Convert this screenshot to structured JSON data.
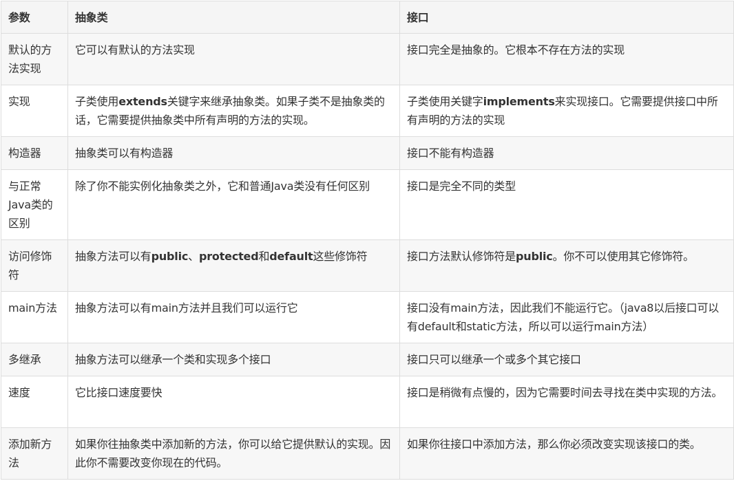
{
  "table": {
    "headers": [
      "参数",
      "抽象类",
      "接口"
    ],
    "rows": [
      {
        "param": "默认的方法实现",
        "abstract": [
          {
            "t": "它可以有默认的方法实现"
          }
        ],
        "interface": [
          {
            "t": "接口完全是抽象的。它根本不存在方法的实现"
          }
        ]
      },
      {
        "param": "实现",
        "abstract": [
          {
            "t": "子类使用"
          },
          {
            "t": "extends",
            "b": true
          },
          {
            "t": "关键字来继承抽象类。如果子类不是抽象类的话，它需要提供抽象类中所有声明的方法的实现。"
          }
        ],
        "interface": [
          {
            "t": "子类使用关键字"
          },
          {
            "t": "implements",
            "b": true
          },
          {
            "t": "来实现接口。它需要提供接口中所有声明的方法的实现"
          }
        ]
      },
      {
        "param": "构造器",
        "abstract": [
          {
            "t": "抽象类可以有构造器"
          }
        ],
        "interface": [
          {
            "t": "接口不能有构造器"
          }
        ]
      },
      {
        "param": "与正常Java类的区别",
        "abstract": [
          {
            "t": "除了你不能实例化抽象类之外，它和普通Java类没有任何区别"
          }
        ],
        "interface": [
          {
            "t": "接口是完全不同的类型"
          }
        ]
      },
      {
        "param": "访问修饰符",
        "abstract": [
          {
            "t": "抽象方法可以有"
          },
          {
            "t": "public",
            "b": true
          },
          {
            "t": "、"
          },
          {
            "t": "protected",
            "b": true
          },
          {
            "t": "和"
          },
          {
            "t": "default",
            "b": true
          },
          {
            "t": "这些修饰符"
          }
        ],
        "interface": [
          {
            "t": "接口方法默认修饰符是"
          },
          {
            "t": "public",
            "b": true
          },
          {
            "t": "。你不可以使用其它修饰符。"
          }
        ]
      },
      {
        "param": "main方法",
        "abstract": [
          {
            "t": "抽象方法可以有main方法并且我们可以运行它"
          }
        ],
        "interface": [
          {
            "t": "接口没有main方法，因此我们不能运行它。（java8以后接口可以有default和static方法，所以可以运行main方法）"
          }
        ]
      },
      {
        "param": "多继承",
        "abstract": [
          {
            "t": "抽象方法可以继承一个类和实现多个接口"
          }
        ],
        "interface": [
          {
            "t": "接口只可以继承一个或多个其它接口"
          }
        ]
      },
      {
        "param": "速度",
        "abstract": [
          {
            "t": "它比接口速度要快"
          }
        ],
        "interface": [
          {
            "t": "接口是稍微有点慢的，因为它需要时间去寻找在类中实现的方法。"
          }
        ]
      },
      {
        "param": "添加新方法",
        "abstract": [
          {
            "t": "如果你往抽象类中添加新的方法，你可以给它提供默认的实现。因此你不需要改变你现在的代码。"
          }
        ],
        "interface": [
          {
            "t": "如果你往接口中添加方法，那么你必须改变实现该接口的类。"
          }
        ]
      }
    ]
  }
}
